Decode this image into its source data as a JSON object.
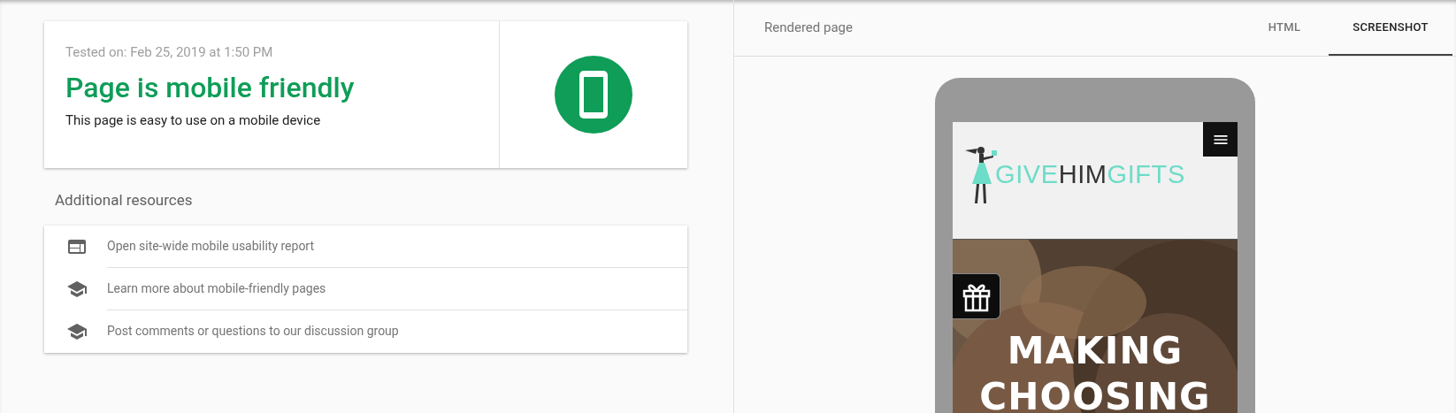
{
  "result": {
    "tested_on": "Tested on: Feb 25, 2019 at 1:50 PM",
    "title": "Page is mobile friendly",
    "subtitle": "This page is easy to use on a mobile device"
  },
  "resources": {
    "heading": "Additional resources",
    "items": [
      {
        "kind": "report",
        "label": "Open site-wide mobile usability report"
      },
      {
        "kind": "learn",
        "label": "Learn more about mobile-friendly pages"
      },
      {
        "kind": "learn",
        "label": "Post comments or questions to our discussion group"
      }
    ]
  },
  "rendered": {
    "title": "Rendered page",
    "tabs": [
      {
        "label": "HTML",
        "selected": false
      },
      {
        "label": "SCREENSHOT",
        "selected": true
      }
    ],
    "site": {
      "logo": [
        {
          "text": "GIVE",
          "color": "#6ddcc8"
        },
        {
          "text": "HIM",
          "color": "#333333"
        },
        {
          "text": "GIFTS",
          "color": "#6ddcc8"
        }
      ],
      "headline": [
        "MAKING",
        "CHOOSING"
      ]
    }
  }
}
